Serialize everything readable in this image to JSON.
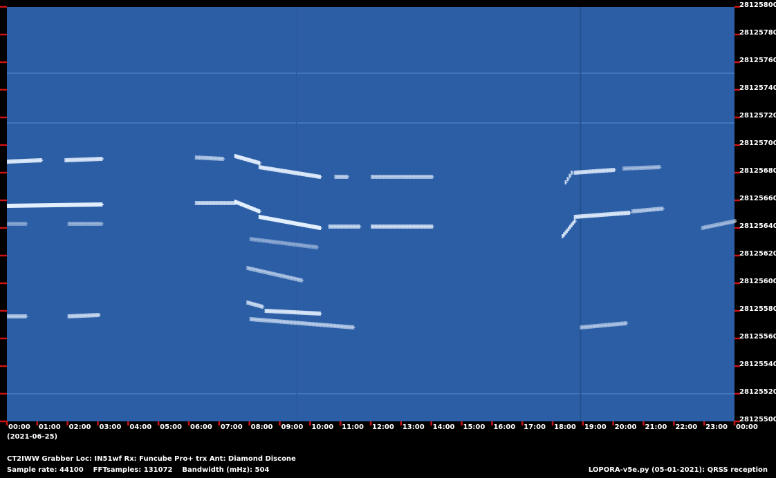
{
  "chart_data": {
    "type": "heatmap",
    "x_ticks": [
      "00:00",
      "01:00",
      "02:00",
      "03:00",
      "04:00",
      "05:00",
      "06:00",
      "07:00",
      "08:00",
      "09:00",
      "10:00",
      "11:00",
      "12:00",
      "13:00",
      "14:00",
      "15:00",
      "16:00",
      "17:00",
      "18:00",
      "19:00",
      "20:00",
      "21:00",
      "22:00",
      "23:00",
      "00:00"
    ],
    "date": "(2021-06-25)",
    "y_ticks": [
      "28125800",
      "28125780",
      "28125760",
      "28125740",
      "28125720",
      "28125700",
      "28125680",
      "28125660",
      "28125640",
      "28125620",
      "28125600",
      "28125580",
      "28125560",
      "28125540",
      "28125520",
      "28125500"
    ],
    "ylim": [
      28125500,
      28125800
    ],
    "xlim_hours": [
      0,
      24
    ],
    "colors": {
      "background": "#2c5ea6",
      "signal": "#e8f2ff",
      "tick": "#cc1111"
    }
  },
  "footer": {
    "station": "CT2IWW Grabber Loc: IN51wf Rx: Funcube Pro+ trx Ant: Diamond Discone",
    "params": "Sample rate: 44100    FFTsamples: 131072    Bandwidth (mHz): 504",
    "software": "LOPORA-v5e.py (05-01-2021): QRSS reception"
  }
}
